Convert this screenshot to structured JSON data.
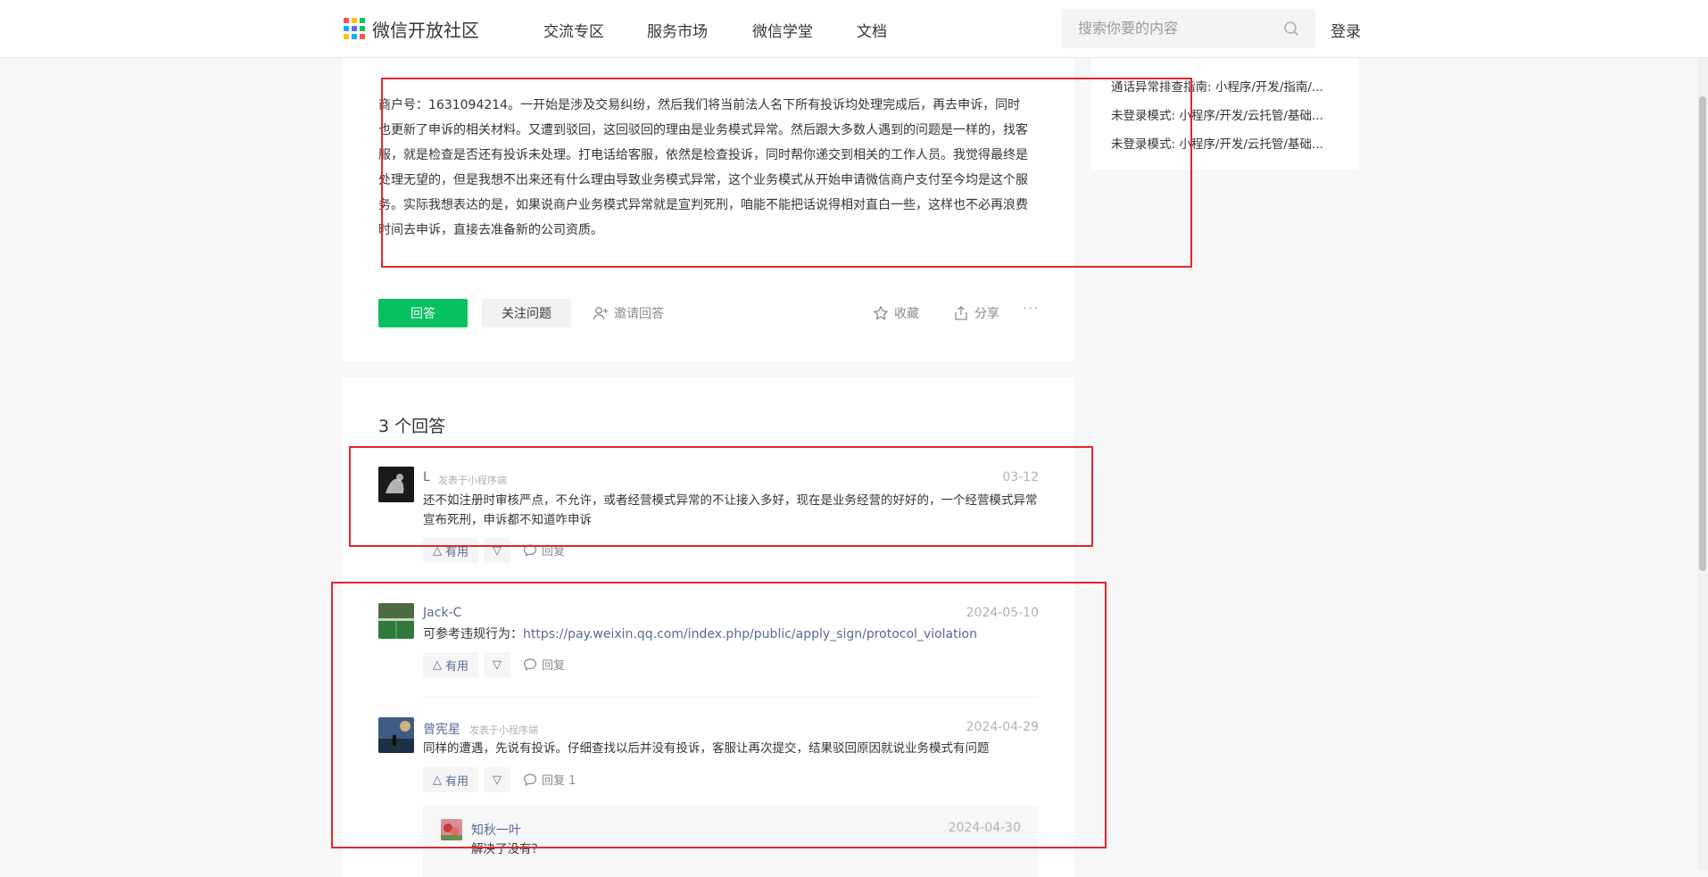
{
  "nav": {
    "brand": "微信开放社区",
    "links": [
      "交流专区",
      "服务市场",
      "微信学堂",
      "文档"
    ],
    "search_placeholder": "搜索你要的内容",
    "login": "登录"
  },
  "question": {
    "body": "商户号：1631094214。一开始是涉及交易纠纷，然后我们将当前法人名下所有投诉均处理完成后，再去申诉，同时也更新了申诉的相关材料。又遭到驳回，这回驳回的理由是业务模式异常。然后跟大多数人遇到的问题是一样的，找客服，就是检查是否还有投诉未处理。打电话给客服，依然是检查投诉，同时帮你递交到相关的工作人员。我觉得最终是处理无望的，但是我想不出来还有什么理由导致业务模式异常，这个业务模式从开始申请微信商户支付至今均是这个服务。实际我想表达的是，如果说商户业务模式异常就是宣判死刑，咱能不能把话说得相对直白一些，这样也不必再浪费时间去申诉，直接去准备新的公司资质。",
    "answer_button": "回答",
    "follow_button": "关注问题",
    "invite_label": "邀请回答",
    "collect_label": "收藏",
    "share_label": "分享",
    "more_label": "···"
  },
  "sidebar": {
    "links": [
      "通话异常排查指南: 小程序/开发/指南/...",
      "未登录模式: 小程序/开发/云托管/基础...",
      "未登录模式: 小程序/开发/云托管/基础..."
    ]
  },
  "answers": {
    "count_label": "3 个回答",
    "items": [
      {
        "name": "L",
        "from": "发表于小程序端",
        "date": "03-12",
        "text": "还不如注册时审核严点，不允许，或者经营模式异常的不让接入多好，现在是业务经营的好好的，一个经营模式异常宣布死刑，申诉都不知道咋申诉",
        "useful": "有用",
        "reply": "回复"
      },
      {
        "name": "Jack-C",
        "date": "2024-05-10",
        "text_prefix": "可参考违规行为：",
        "link": "https://pay.weixin.qq.com/index.php/public/apply_sign/protocol_violation",
        "useful": "有用",
        "reply": "回复"
      },
      {
        "name": "曾宪星",
        "from": "发表于小程序端",
        "date": "2024-04-29",
        "text": "同样的遭遇，先说有投诉。仔细查找以后并没有投诉，客服让再次提交，结果驳回原因就说业务模式有问题",
        "useful": "有用",
        "reply": "回复 1"
      }
    ],
    "sub_reply": {
      "name": "知秋一叶",
      "date": "2024-04-30",
      "text": "解决了没有？"
    }
  },
  "colors": {
    "primary_green": "#07c160",
    "link_blue": "#576b95",
    "annotation_red": "#e3262b"
  }
}
